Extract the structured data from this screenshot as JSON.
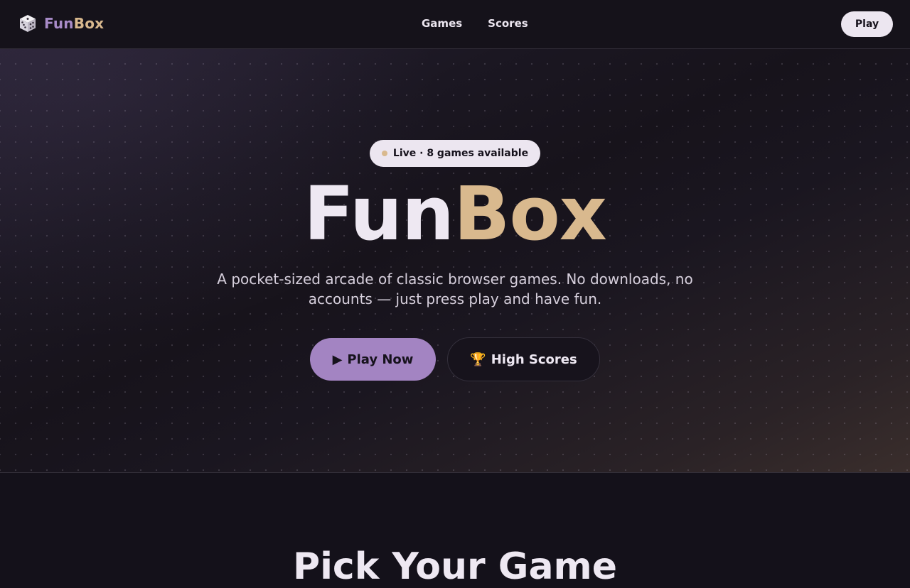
{
  "nav": {
    "logo_icon": "dice-icon",
    "brand_part1": "Fun",
    "brand_part2": "Box",
    "links": [
      "Games",
      "Scores"
    ],
    "play_label": "Play"
  },
  "hero": {
    "badge_text": "Live · 8 games available",
    "title_part1": "Fun",
    "title_part2": "Box",
    "subtitle": "A pocket-sized arcade of classic browser games. No downloads, no accounts — just press play and have fun.",
    "primary_icon": "▶",
    "primary_label": "Play Now",
    "secondary_icon": "🏆",
    "secondary_label": "High Scores"
  },
  "section": {
    "title": "Pick Your Game"
  },
  "colors": {
    "accent_purple": "#a384c2",
    "accent_gold": "#d9b98e",
    "background": "#14111a"
  }
}
